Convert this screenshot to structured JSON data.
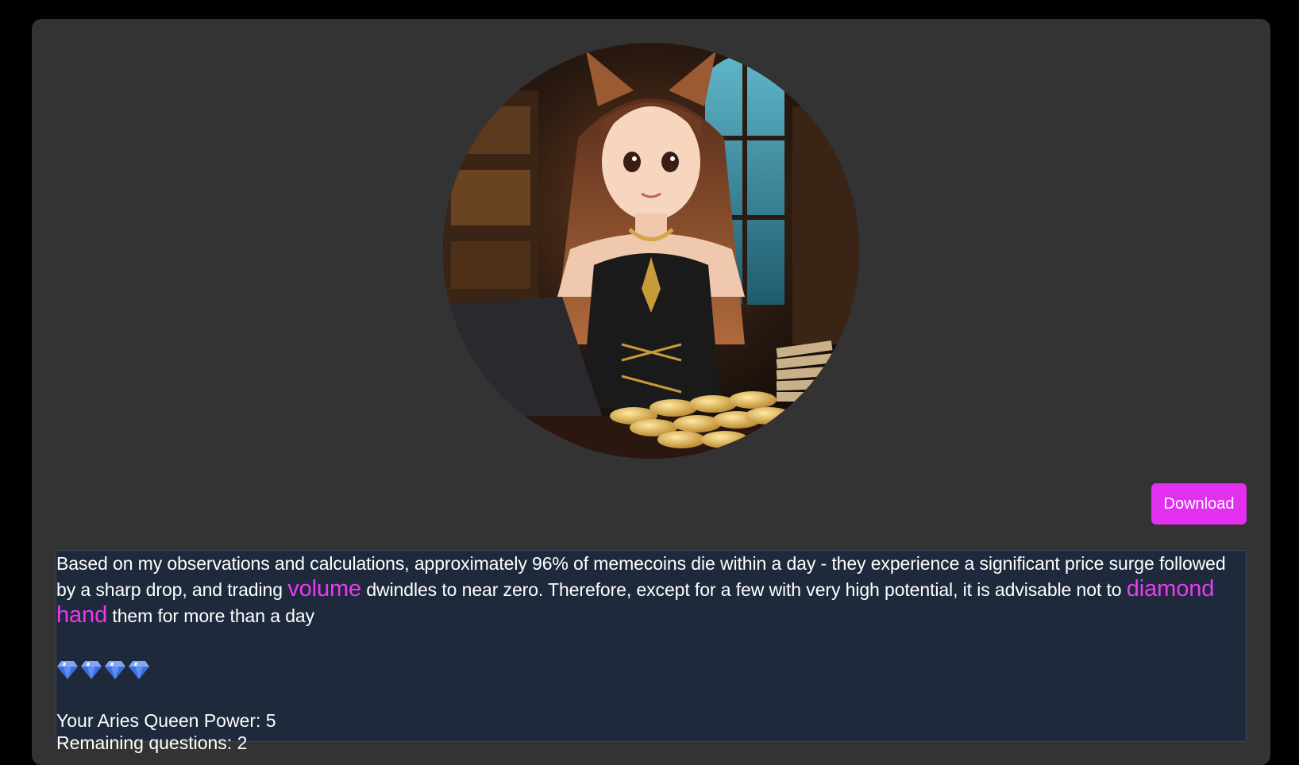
{
  "actions": {
    "download_label": "Download"
  },
  "answer": {
    "text_1": "Based on my observations and calculations, approximately 96% of memecoins die within a day - they experience a significant price surge followed by a sharp drop, and trading ",
    "keyword_1": "volume",
    "text_2": " dwindles to near zero. Therefore, except for a few with very high potential, it is advisable not to ",
    "keyword_2": "diamond hand",
    "text_3": " them for more than a day",
    "diamond_rating": 4,
    "diamond_icon": "gem-icon"
  },
  "stats": {
    "power_label": "Your Aries Queen Power: 5",
    "remaining_label": "Remaining questions: 2"
  },
  "colors": {
    "page_bg": "#000000",
    "card_bg": "#333333",
    "accent": "#e22ff0",
    "answer_bg": "#1e2a3b",
    "diamond": "#3b6fe0"
  }
}
